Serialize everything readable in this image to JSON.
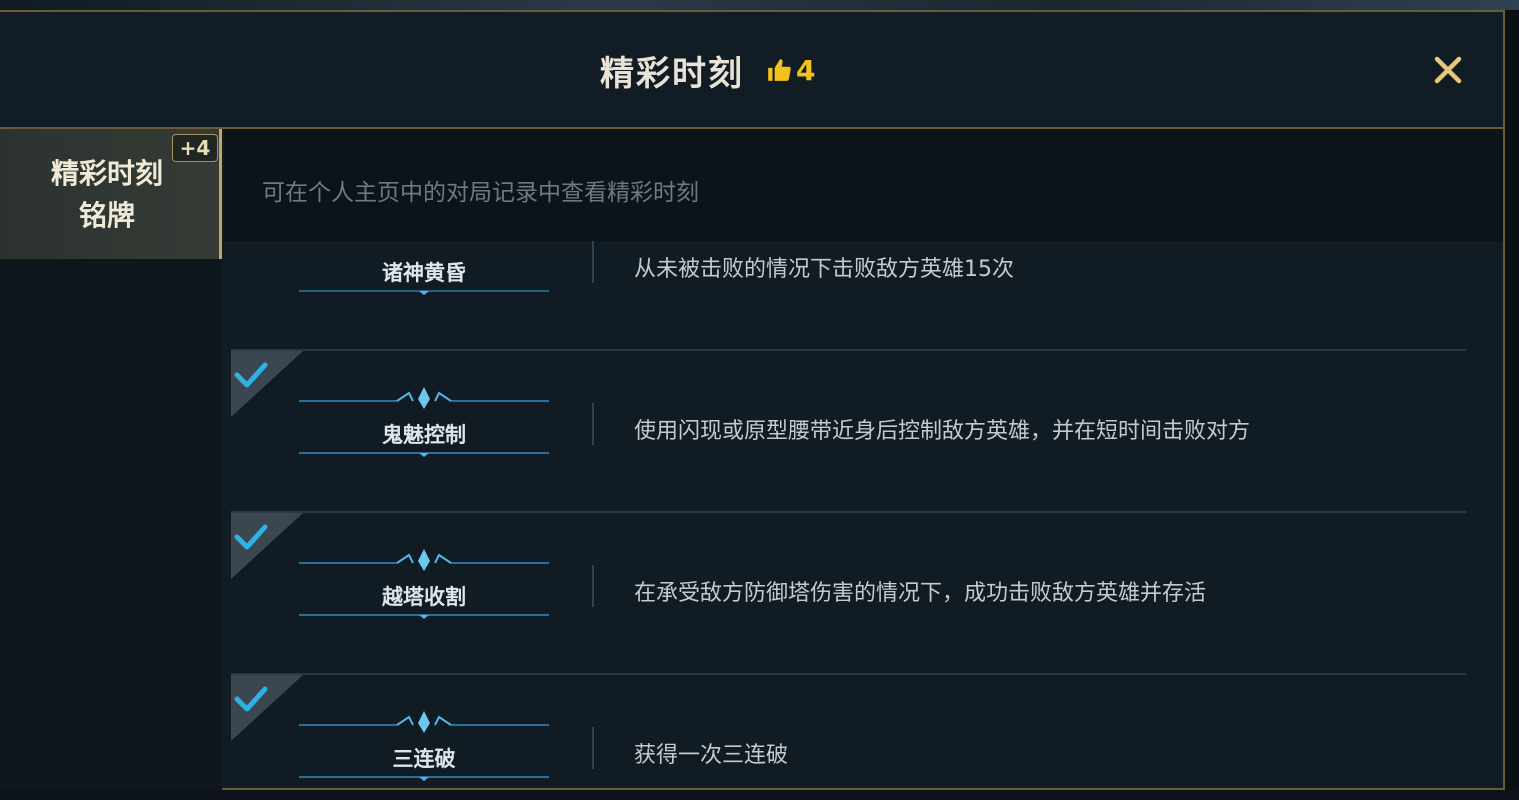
{
  "header": {
    "title": "精彩时刻",
    "like_count": "4",
    "like_icon": "thumbs-up-icon",
    "close_icon": "close-icon"
  },
  "sidebar": {
    "tab_label": "精彩时刻\n铭牌",
    "badge": "+4"
  },
  "info": {
    "text": "可在个人主页中的对局记录中查看精彩时刻"
  },
  "moments": [
    {
      "name": "诸神黄昏",
      "description": "从未被击败的情况下击败敌方英雄15次",
      "checked": false
    },
    {
      "name": "鬼魅控制",
      "description": "使用闪现或原型腰带近身后控制敌方英雄，并在短时间击败对方",
      "checked": true
    },
    {
      "name": "越塔收割",
      "description": "在承受敌方防御塔伤害的情况下，成功击败敌方英雄并存活",
      "checked": true
    },
    {
      "name": "三连破",
      "description": "获得一次三连破",
      "checked": true
    }
  ],
  "colors": {
    "accent_gold": "#f2c21a",
    "border_gold": "#6b5a36",
    "check_cyan": "#2bb3e6"
  }
}
